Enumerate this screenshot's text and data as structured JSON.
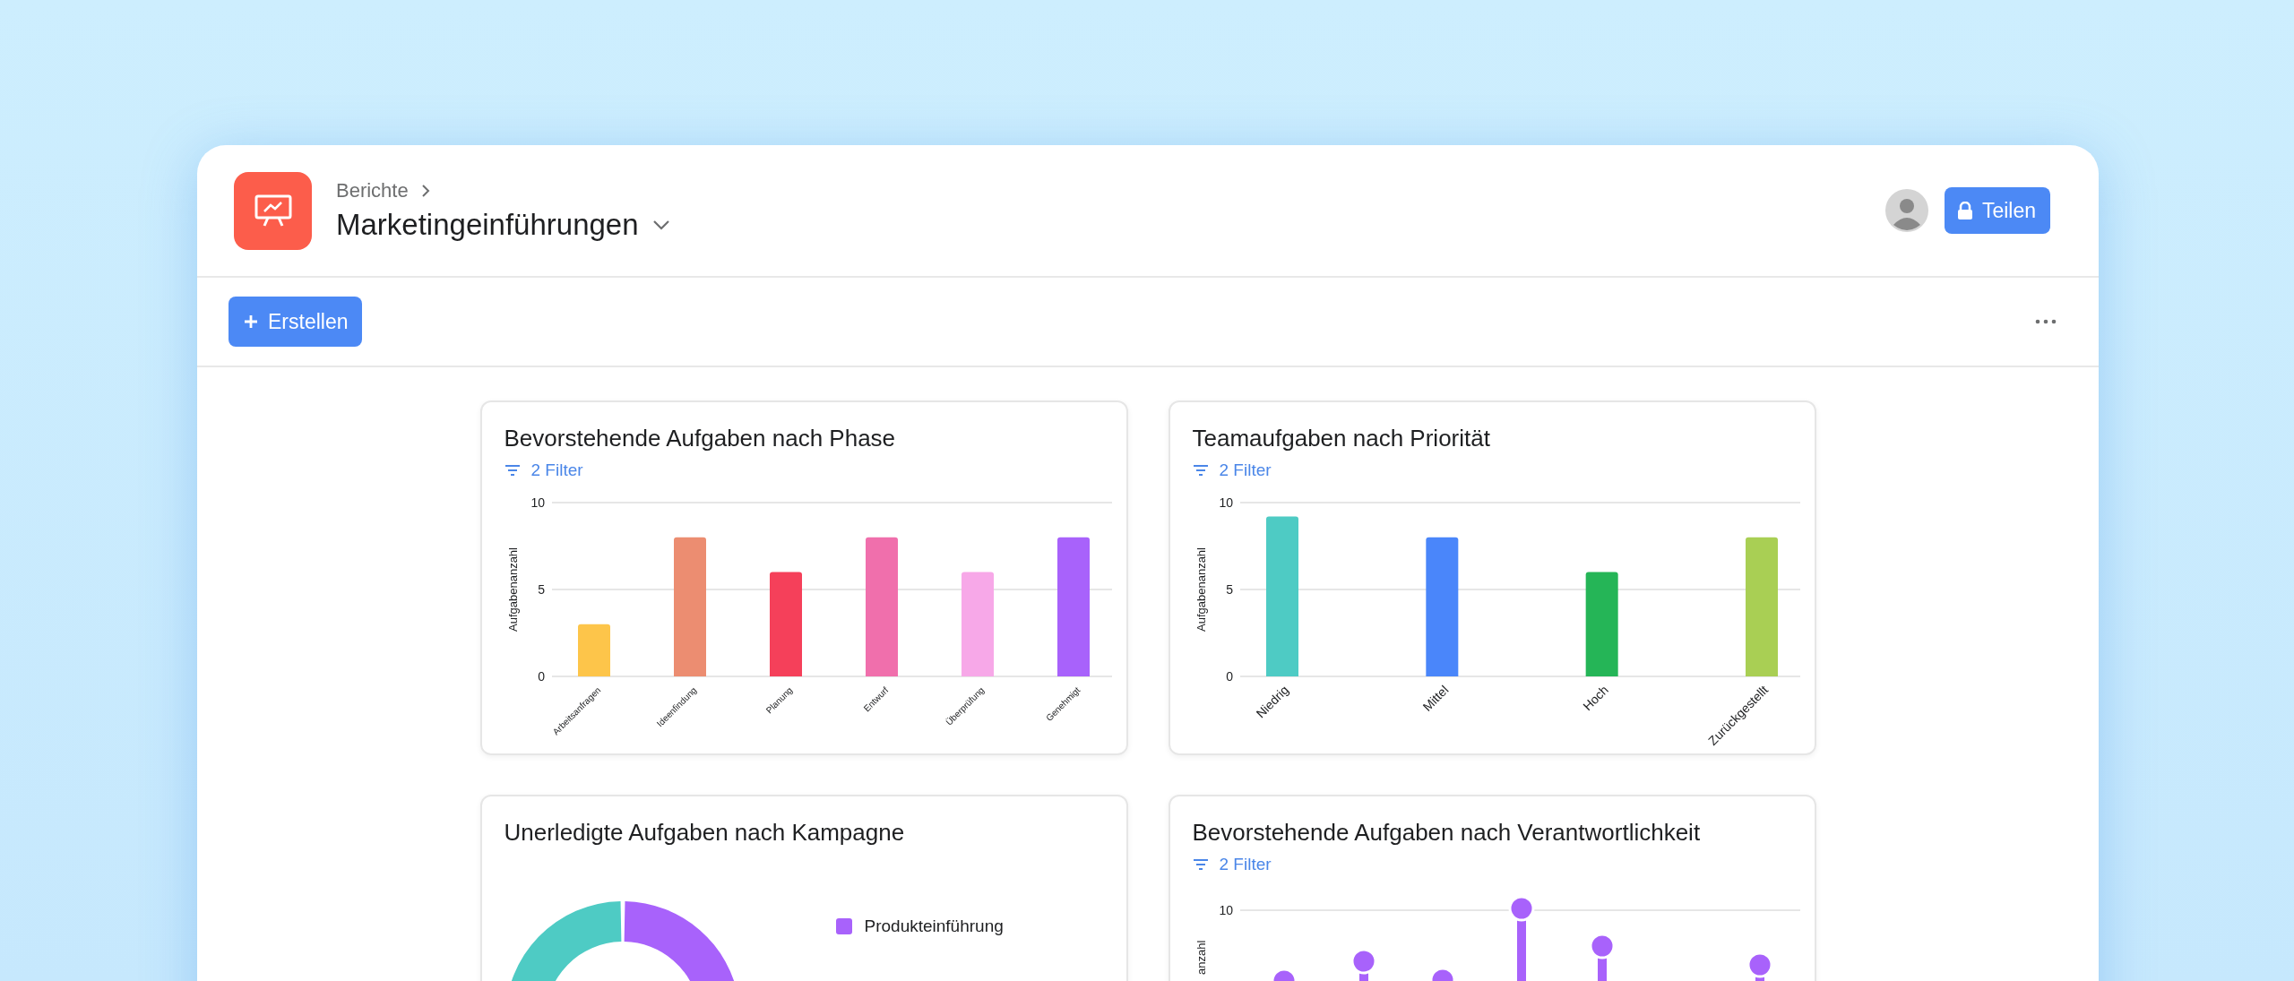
{
  "header": {
    "breadcrumb": "Berichte",
    "title": "Marketingeinführungen"
  },
  "actions": {
    "share_button": "Teilen"
  },
  "toolbar": {
    "create_button": "Erstellen"
  },
  "cards": [
    {
      "kind": "bar",
      "title": "Bevorstehende Aufgaben nach Phase",
      "filter": "2 Filter",
      "chart_data": {
        "type": "bar",
        "ylabel": "Aufgabenanzahl",
        "categories": [
          "Arbeitsanfragen",
          "Ideenfindung",
          "Planung",
          "Entwurf",
          "Überprüfung",
          "Genehmigt"
        ],
        "ylim": [
          0,
          10
        ],
        "yticks": [
          0,
          5,
          10
        ],
        "series": [
          {
            "colors": [
              "#fdc54a",
              "#ec8d71",
              "#f5405a",
              "#f06fac",
              "#f7a8e8",
              "#a862fb"
            ],
            "values": [
              3,
              8,
              6,
              8,
              6,
              8
            ]
          }
        ]
      }
    },
    {
      "kind": "bar",
      "title": "Teamaufgaben nach Priorität",
      "filter": "2 Filter",
      "chart_data": {
        "type": "bar",
        "ylabel": "Aufgabenanzahl",
        "categories": [
          "Niedrig",
          "Mittel",
          "Hoch",
          "Zurückgestellt"
        ],
        "ylim": [
          0,
          10
        ],
        "yticks": [
          0,
          5,
          10
        ],
        "series": [
          {
            "colors": [
              "#4ecbc4",
              "#4a86fa",
              "#25b557",
              "#a9cf54"
            ],
            "values": [
              9.2,
              8,
              6,
              8
            ]
          }
        ]
      }
    },
    {
      "kind": "donut",
      "title": "Unerledigte Aufgaben nach Kampagne",
      "legend": [
        {
          "label": "Produkteinführung",
          "color": "#a862fb"
        }
      ]
    },
    {
      "kind": "lollipop",
      "title": "Bevorstehende Aufgaben nach Verantwortlichkeit",
      "filter": "2 Filter",
      "y_tick": "10",
      "y_label": "anzahl"
    }
  ]
}
